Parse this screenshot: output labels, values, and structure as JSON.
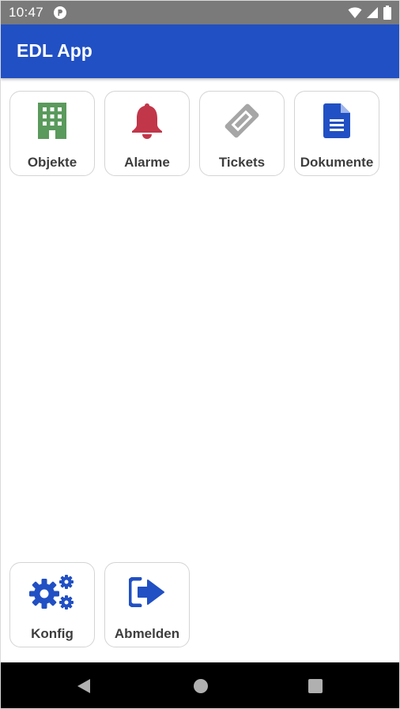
{
  "status_bar": {
    "time": "10:47",
    "icons": [
      "app-notification-icon",
      "wifi-icon",
      "signal-icon",
      "battery-icon"
    ]
  },
  "app_bar": {
    "title": "EDL App"
  },
  "menu_tiles": [
    {
      "label": "Objekte",
      "icon": "building-icon",
      "color": "#5a9a5c"
    },
    {
      "label": "Alarme",
      "icon": "bell-icon",
      "color": "#c2364a"
    },
    {
      "label": "Tickets",
      "icon": "ticket-icon",
      "color": "#a6a6a6"
    },
    {
      "label": "Dokumente",
      "icon": "document-icon",
      "color": "#2150c4"
    }
  ],
  "bottom_tiles": [
    {
      "label": "Konfig",
      "icon": "gears-icon",
      "color": "#2150c4"
    },
    {
      "label": "Abmelden",
      "icon": "logout-icon",
      "color": "#2150c4"
    }
  ],
  "nav_bar": {
    "buttons": [
      "back-icon",
      "home-icon",
      "recents-icon"
    ]
  },
  "colors": {
    "accent": "#2150c4",
    "status_bar": "#7a7a7a",
    "nav_bar": "#000000"
  }
}
